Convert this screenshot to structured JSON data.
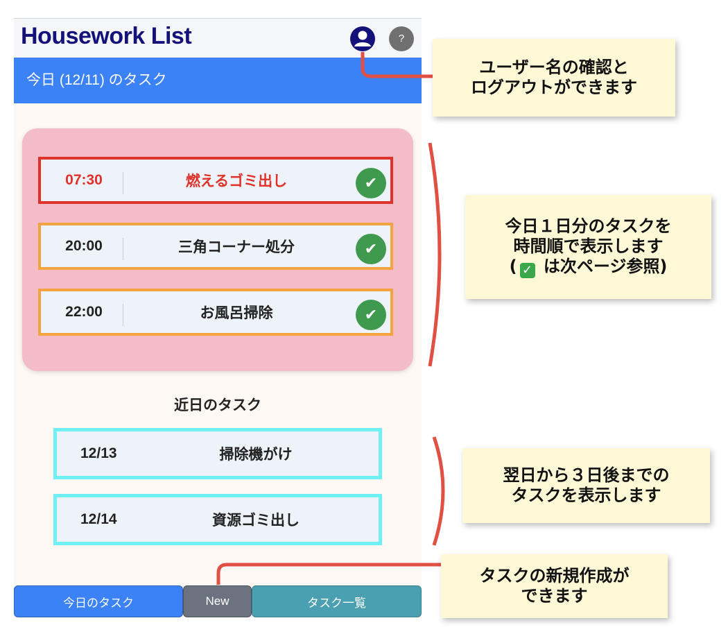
{
  "header": {
    "app_title": "Housework List",
    "help_label": "?"
  },
  "today": {
    "heading": "今日 (12/11) のタスク",
    "tasks": [
      {
        "time": "07:30",
        "name": "燃えるゴミ出し",
        "status": "overdue",
        "check": "✔"
      },
      {
        "time": "20:00",
        "name": "三角コーナー処分",
        "status": "pending",
        "check": "✔"
      },
      {
        "time": "22:00",
        "name": "お風呂掃除",
        "status": "pending",
        "check": "✔"
      }
    ]
  },
  "upcoming": {
    "heading": "近日のタスク",
    "tasks": [
      {
        "date": "12/13",
        "name": "掃除機がけ"
      },
      {
        "date": "12/14",
        "name": "資源ゴミ出し"
      }
    ]
  },
  "bottom_nav": {
    "today_label": "今日のタスク",
    "new_label": "New",
    "list_label": "タスク一覧"
  },
  "annotations": {
    "user": [
      "ユーザー名の確認と",
      "ログアウトができます"
    ],
    "today": [
      "今日１日分のタスクを",
      "時間順で表示します",
      "(",
      " は次ページ参照)"
    ],
    "upcoming": [
      "翌日から３日後までの",
      "タスクを表示します"
    ],
    "new": [
      "タスクの新規作成が",
      "できます"
    ]
  },
  "colors": {
    "title": "#14127a",
    "header_bar": "#3b82f6",
    "today_panel": "#f3bcc7",
    "overdue_border": "#e0322b",
    "pending_border": "#f4a340",
    "upcoming_border": "#6ef0f5",
    "check": "#3f9a4f",
    "annotation_bg": "#fff8d6",
    "annotation_line": "#e05044"
  }
}
